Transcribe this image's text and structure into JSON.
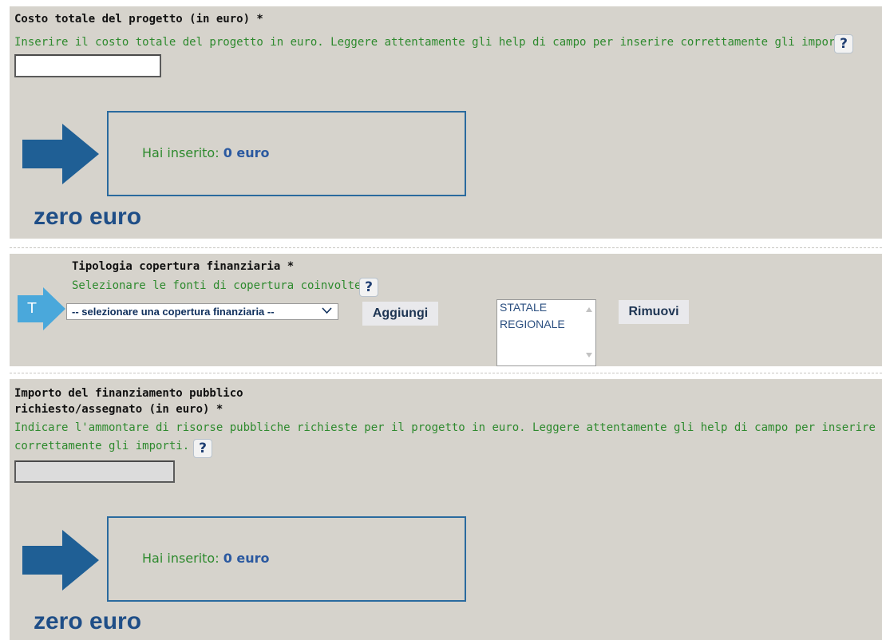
{
  "section1": {
    "title": "Costo totale del progetto (in euro) *",
    "help": "Inserire il costo totale del progetto in euro. Leggere attentamente gli help di campo per inserire correttamente gli importi.",
    "help_button": "?",
    "input_value": "",
    "output_label": "Hai inserito:",
    "output_value": "0 euro",
    "words": "zero euro"
  },
  "section2": {
    "title": "Tipologia copertura finanziaria *",
    "help": "Selezionare le fonti di copertura coinvolte.",
    "help_button": "?",
    "marker": "T",
    "select_value": "-- selezionare una copertura finanziaria --",
    "add_button": "Aggiungi",
    "list_items": [
      "STATALE",
      "REGIONALE"
    ],
    "remove_button": "Rimuovi"
  },
  "section3": {
    "title_line1": "Importo del finanziamento pubblico",
    "title_line2": "richiesto/assegnato (in euro) *",
    "help_line1": "Indicare l'ammontare di risorse pubbliche richieste per il progetto in euro. Leggere attentamente gli help di campo per inserire",
    "help_line2": "correttamente gli importi.",
    "help_button": "?",
    "input_value": "",
    "output_label": "Hai inserito:",
    "output_value": "0 euro",
    "words": "zero euro"
  },
  "colors": {
    "panel_bg": "#d6d3cc",
    "help_green": "#2e8a2e",
    "arrow_blue": "#1f5f95",
    "marker_blue": "#4aa8db",
    "words_blue": "#1f4e87"
  }
}
